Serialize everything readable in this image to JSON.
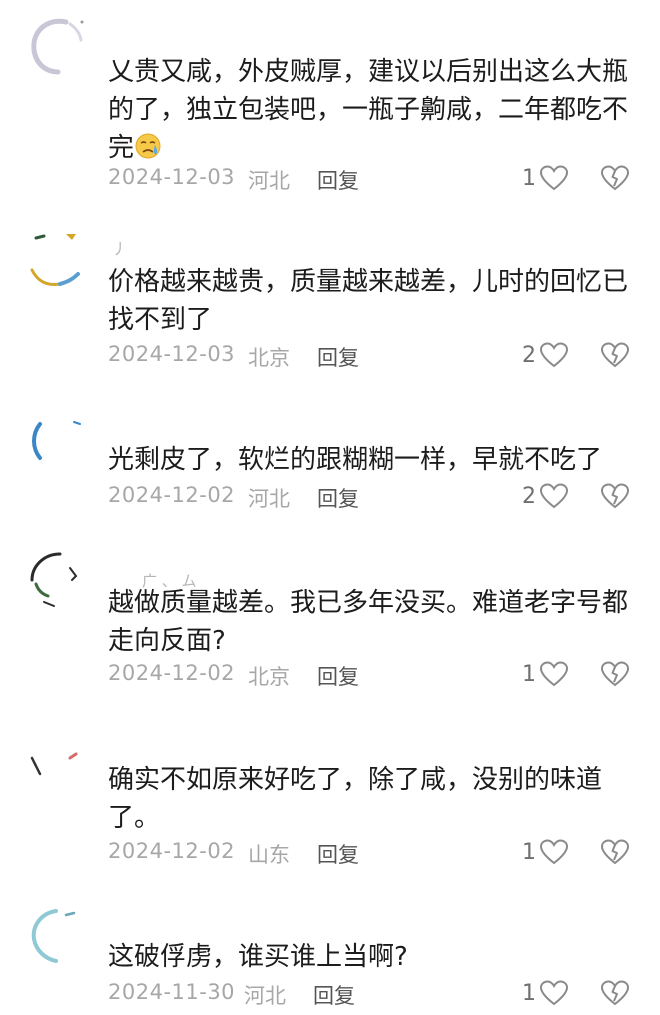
{
  "comments": [
    {
      "nickname": "",
      "text": "乂贵又咸，外皮贼厚，建议以后别出这么大瓶的了，独立包装吧，一瓶子齁咸，二年都吃不完",
      "emoji": "crying-face-emoji",
      "date": "2024-12-03",
      "location": "河北",
      "reply_label": "回复",
      "likes": "1"
    },
    {
      "nickname": "丿",
      "text": "价格越来越贵，质量越来越差，儿时的回忆已找不到了",
      "date": "2024-12-03",
      "location": "北京",
      "reply_label": "回复",
      "likes": "2"
    },
    {
      "nickname": "",
      "text": "光剩皮了，软烂的跟糊糊一样，早就不吃了",
      "date": "2024-12-02",
      "location": "河北",
      "reply_label": "回复",
      "likes": "2"
    },
    {
      "nickname": "广 、 ム",
      "text": "越做质量越差。我已多年没买。难道老字号都走向反面?",
      "date": "2024-12-02",
      "location": "北京",
      "reply_label": "回复",
      "likes": "1"
    },
    {
      "nickname": "",
      "text": "确实不如原来好吃了，除了咸，没别的味道了。",
      "date": "2024-12-02",
      "location": "山东",
      "reply_label": "回复",
      "likes": "1"
    },
    {
      "nickname": "",
      "text": "这破俘虏，谁买谁上当啊?",
      "date": "2024-11-30",
      "location": "河北",
      "reply_label": "回复",
      "likes": "1"
    }
  ],
  "colors": {
    "text": "#1c1c1c",
    "meta": "#a7a7a7",
    "reply": "#555555",
    "icon": "#8a8a8a"
  }
}
